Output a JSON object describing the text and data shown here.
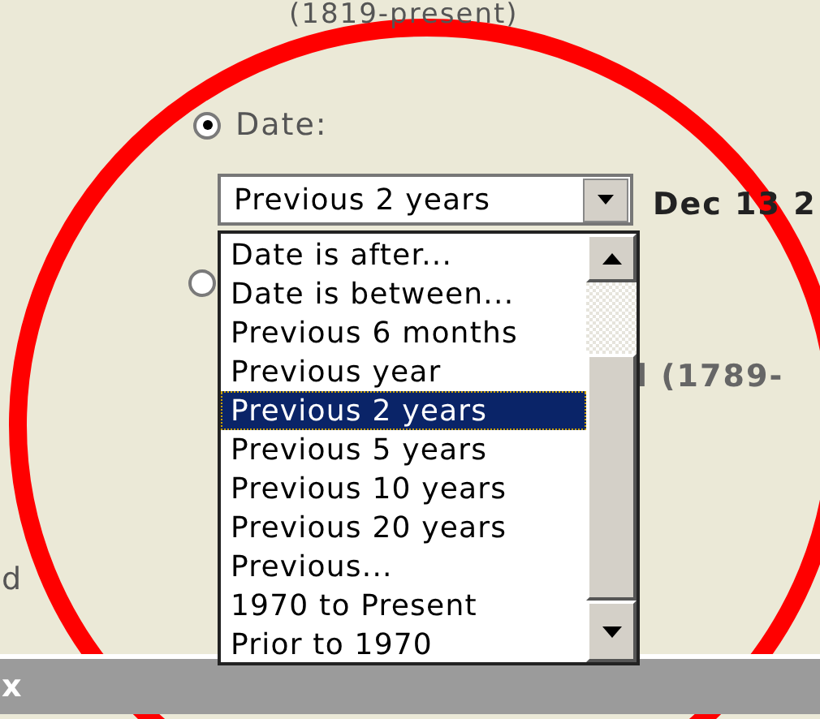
{
  "header_text": "(1819-present)",
  "date_radio": {
    "label": "Date:",
    "selected": true
  },
  "date_select": {
    "value": "Previous 2 years",
    "expanded": true,
    "options": [
      {
        "label": "Date is after...",
        "selected": false
      },
      {
        "label": "Date is between...",
        "selected": false
      },
      {
        "label": "Previous 6 months",
        "selected": false
      },
      {
        "label": "Previous year",
        "selected": false
      },
      {
        "label": "Previous 2 years",
        "selected": true
      },
      {
        "label": "Previous 5 years",
        "selected": false
      },
      {
        "label": "Previous 10 years",
        "selected": false
      },
      {
        "label": "Previous 20 years",
        "selected": false
      },
      {
        "label": "Previous...",
        "selected": false
      },
      {
        "label": "1970 to Present",
        "selected": false
      },
      {
        "label": "Prior to 1970",
        "selected": false
      }
    ]
  },
  "date_reading": "Dec 13 2",
  "other_radio": {
    "selected": false
  },
  "range_text": "l (1789-",
  "left_text": "d",
  "bottom_bar": {
    "text": "x"
  }
}
